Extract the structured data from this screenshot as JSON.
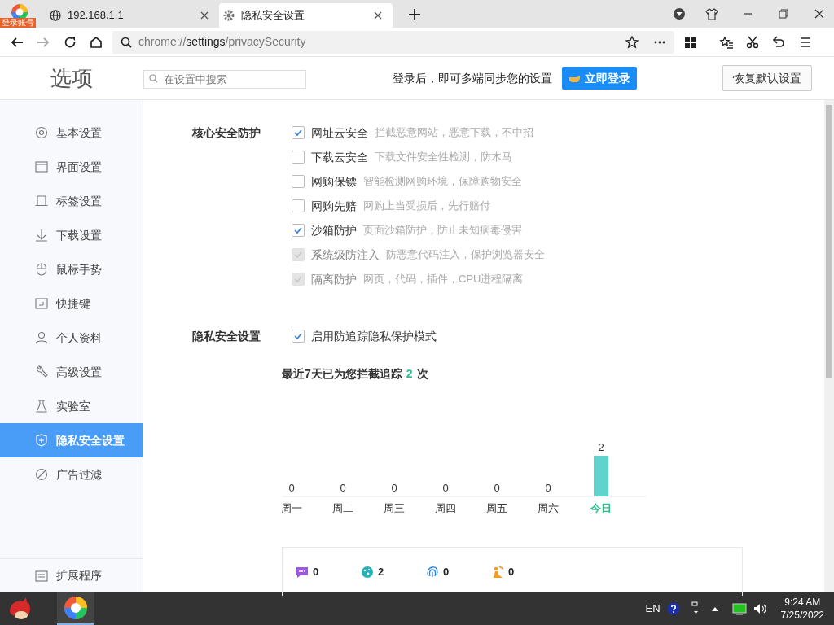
{
  "browser": {
    "account_badge": "登录账号",
    "tabs": [
      {
        "title": "192.168.1.1",
        "selected": false
      },
      {
        "title": "隐私安全设置",
        "selected": true
      }
    ],
    "address": {
      "scheme": "chrome://",
      "host": "settings",
      "path": "/privacySecurity"
    }
  },
  "header": {
    "title": "选项",
    "search": {
      "placeholder": "在设置中搜索"
    },
    "sync_text": "登录后，即可多端同步您的设置",
    "login_button": "立即登录",
    "reset_button": "恢复默认设置"
  },
  "sidebar": {
    "items": [
      {
        "label": "基本设置",
        "selected": false
      },
      {
        "label": "界面设置",
        "selected": false
      },
      {
        "label": "标签设置",
        "selected": false
      },
      {
        "label": "下载设置",
        "selected": false
      },
      {
        "label": "鼠标手势",
        "selected": false
      },
      {
        "label": "快捷键",
        "selected": false
      },
      {
        "label": "个人资料",
        "selected": false
      },
      {
        "label": "高级设置",
        "selected": false
      },
      {
        "label": "实验室",
        "selected": false
      },
      {
        "label": "隐私安全设置",
        "selected": true
      },
      {
        "label": "广告过滤",
        "selected": false
      }
    ],
    "extensions": "扩展程序"
  },
  "sections": [
    {
      "title": "核心安全防护",
      "options": [
        {
          "label": "网址云安全",
          "description": "拦截恶意网站，恶意下载，不中招",
          "checked": true,
          "disabled": false
        },
        {
          "label": "下载云安全",
          "description": "下载文件安全性检测，防木马",
          "checked": false,
          "disabled": false
        },
        {
          "label": "网购保镖",
          "description": "智能检测网购环境，保障购物安全",
          "checked": false,
          "disabled": false
        },
        {
          "label": "网购先赔",
          "description": "网购上当受损后，先行赔付",
          "checked": false,
          "disabled": false
        },
        {
          "label": "沙箱防护",
          "description": "页面沙箱防护，防止未知病毒侵害",
          "checked": true,
          "disabled": false
        },
        {
          "label": "系统级防注入",
          "description": "防恶意代码注入，保护浏览器安全",
          "checked": true,
          "disabled": true
        },
        {
          "label": "隔离防护",
          "description": "网页，代码，插件，CPU进程隔离",
          "checked": true,
          "disabled": true
        }
      ]
    },
    {
      "title": "隐私安全设置",
      "options": [
        {
          "label": "启用防追踪隐私保护模式",
          "checked": true,
          "disabled": false
        }
      ]
    }
  ],
  "tracking": {
    "summary_parts": [
      "最近7天已为您拦截追踪",
      "2",
      "次"
    ],
    "chart_data": {
      "type": "bar",
      "categories": [
        "周一",
        "周二",
        "周三",
        "周四",
        "周五",
        "周六",
        "今日"
      ],
      "series": [
        {
          "color": "#5fd3cc",
          "values": [
            0,
            0,
            0,
            0,
            0,
            0,
            2
          ]
        }
      ],
      "data_labels": true
    },
    "stats": [
      {
        "kind": "message",
        "value": "0"
      },
      {
        "kind": "cookie",
        "value": "2"
      },
      {
        "kind": "fingerprint",
        "value": "0"
      },
      {
        "kind": "miner",
        "value": "0"
      }
    ]
  },
  "taskbar": {
    "language": "EN",
    "time": "9:24 AM",
    "date": "7/25/2022"
  }
}
